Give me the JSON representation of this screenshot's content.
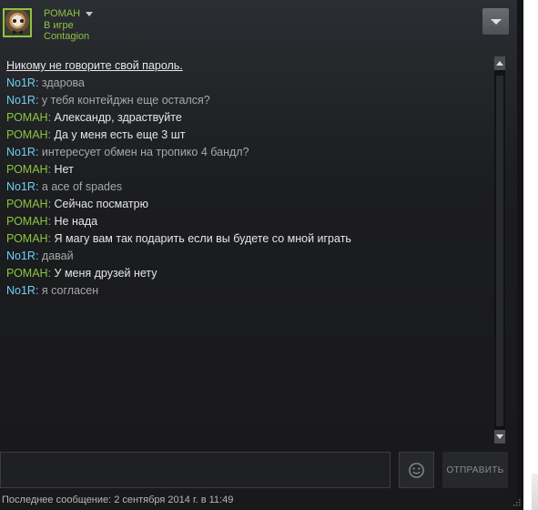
{
  "header": {
    "username": "РОМАН",
    "status": "В игре",
    "game": "Contagion"
  },
  "chat": {
    "warning": "Никому не говорите свой пароль.",
    "messages": [
      {
        "sender": "No1R",
        "self": false,
        "text": "здарова"
      },
      {
        "sender": "No1R",
        "self": false,
        "text": "у тебя контейджн еще остался?"
      },
      {
        "sender": "РОМАН",
        "self": true,
        "text": "Александр, здраствуйте"
      },
      {
        "sender": "РОМАН",
        "self": true,
        "text": "Да у меня есть еще 3 шт"
      },
      {
        "sender": "No1R",
        "self": false,
        "text": "интересует обмен на тропико 4 бандл?"
      },
      {
        "sender": "РОМАН",
        "self": true,
        "text": "Нет"
      },
      {
        "sender": "No1R",
        "self": false,
        "text": "a ace of spades"
      },
      {
        "sender": "РОМАН",
        "self": true,
        "text": "Сейчас посматрю"
      },
      {
        "sender": "РОМАН",
        "self": true,
        "text": "Не нада"
      },
      {
        "sender": "РОМАН",
        "self": true,
        "text": "Я магу вам так подарить если вы будете со мной играть"
      },
      {
        "sender": "No1R",
        "self": false,
        "text": "давай"
      },
      {
        "sender": "РОМАН",
        "self": true,
        "text": "У меня друзей нету"
      },
      {
        "sender": "No1R",
        "self": false,
        "text": "я согласен"
      }
    ]
  },
  "composer": {
    "send_label": "ОТПРАВИТЬ"
  },
  "footer": {
    "last_message": "Последнее сообщение: 2 сентября 2014 г. в 11:49"
  },
  "colors": {
    "self_name": "#8bc53f",
    "other_name": "#6dcff6",
    "self_text": "#e6e6e6",
    "other_text": "#a8a8a8"
  },
  "icons": [
    "dropdown-caret-icon",
    "menu-dropdown-icon",
    "scroll-up-icon",
    "scroll-down-icon",
    "emoticon-icon",
    "resize-grip-icon"
  ]
}
